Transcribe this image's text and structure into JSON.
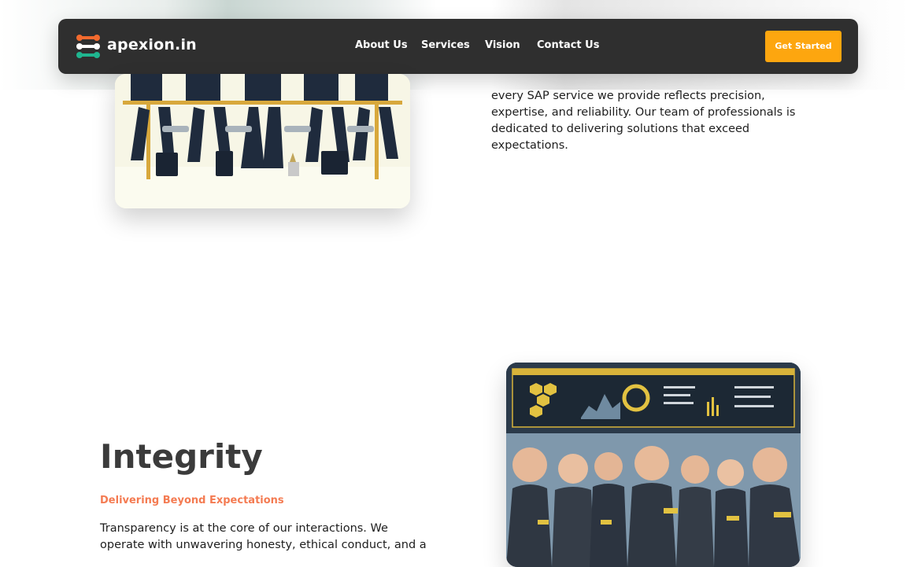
{
  "navbar": {
    "brand": "apexion.in",
    "links": [
      {
        "label": "About Us"
      },
      {
        "label": "Services"
      },
      {
        "label": "Vision"
      },
      {
        "label": "Contact Us"
      }
    ],
    "cta_label": "Get Started"
  },
  "intro": {
    "text": "every SAP service we provide reflects precision, expertise, and reliability. Our team of professionals is dedicated to delivering solutions that exceed expectations."
  },
  "integrity": {
    "title": "Integrity",
    "subtitle": "Delivering Beyond Expectations",
    "body": "Transparency is at the core of our interactions. We operate with unwavering honesty, ethical conduct, and a"
  },
  "colors": {
    "navbar_bg": "#2f2f2f",
    "cta_bg": "#fda60f",
    "subtitle": "#f47b52",
    "title": "#3b3b3b"
  },
  "icons": [
    "logo-icon"
  ]
}
